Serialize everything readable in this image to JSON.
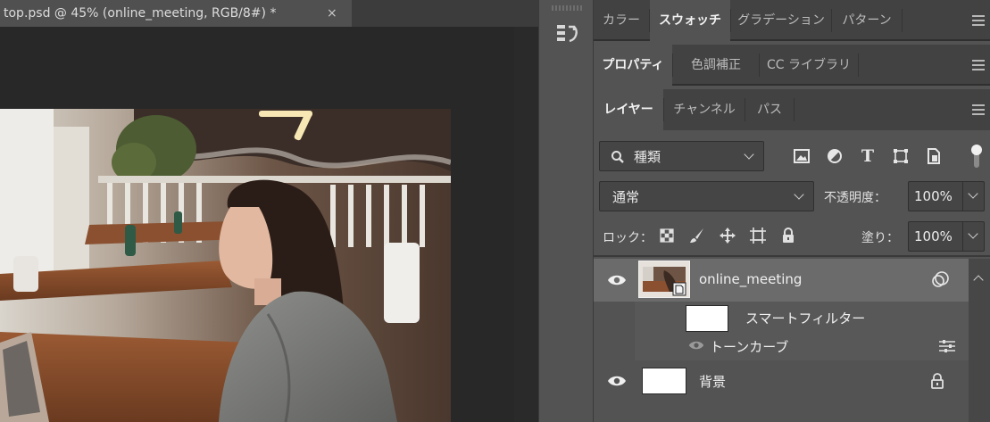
{
  "document": {
    "tab_title": "top.psd @ 45% (online_meeting, RGB/8#) *",
    "close_glyph": "×"
  },
  "panel_groups": {
    "row1": {
      "tabs": [
        "カラー",
        "スウォッチ",
        "グラデーション",
        "パターン"
      ],
      "active_index": 1
    },
    "row2": {
      "tabs": [
        "プロパティ",
        "色調補正",
        "CC ライブラリ"
      ],
      "active_index": 0
    },
    "row3": {
      "tabs": [
        "レイヤー",
        "チャンネル",
        "パス"
      ],
      "active_index": 0
    }
  },
  "layers_panel": {
    "filter_kind": "種類",
    "blend_mode": "通常",
    "opacity_label": "不透明度：",
    "opacity_value": "100%",
    "lock_label": "ロック：",
    "fill_label": "塗り：",
    "fill_value": "100%",
    "filter_icons": [
      "image-filter-icon",
      "adjustment-filter-icon",
      "type-filter-icon",
      "shape-filter-icon",
      "smart-object-filter-icon"
    ],
    "lock_icons": [
      "lock-transparent-pixels-icon",
      "lock-image-pixels-icon",
      "lock-position-icon",
      "lock-artboard-icon",
      "lock-all-icon"
    ],
    "layers": [
      {
        "name": "online_meeting",
        "type": "smart-object",
        "visible": true,
        "selected": true
      },
      {
        "name": "スマートフィルター",
        "type": "smart-filter-group"
      },
      {
        "name": "トーンカーブ",
        "type": "smart-filter",
        "visible": true
      },
      {
        "name": "背景",
        "type": "background",
        "visible": true,
        "locked": true
      }
    ]
  },
  "colors": {
    "panel_bg": "#535353",
    "tab_bar_bg": "#424242",
    "selected_layer": "#6b6b6b",
    "canvas_bg": "#282828"
  }
}
